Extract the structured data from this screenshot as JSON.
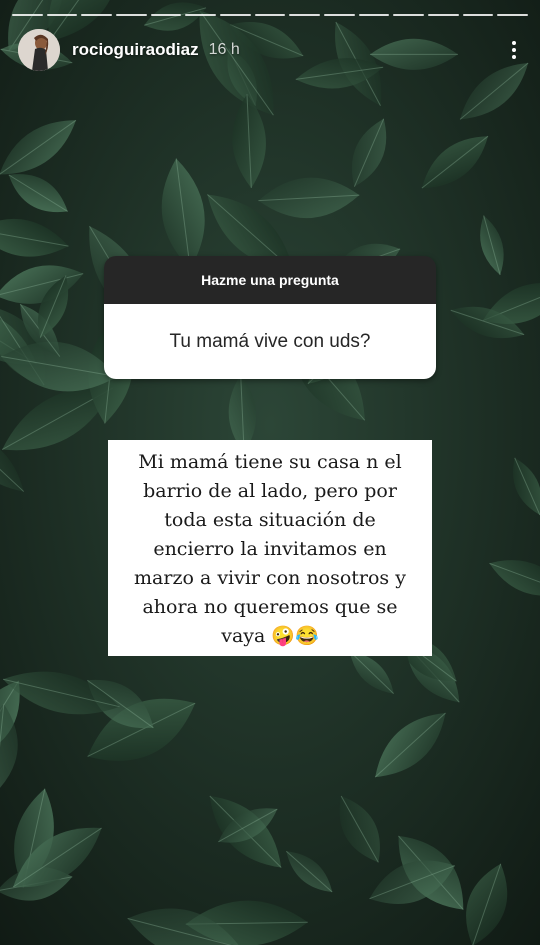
{
  "story": {
    "username": "rocioguiraodiaz",
    "time_ago": "16 h",
    "progress_segments": 15
  },
  "question_sticker": {
    "title": "Hazme una pregunta",
    "question": "Tu mamá vive con uds?"
  },
  "answer": {
    "lines": [
      "Mi mamá tiene su casa n el",
      "barrio de al lado, pero por",
      "toda esta situación de",
      "encierro la invitamos en",
      "marzo a vivir con nosotros y",
      "ahora no queremos que se",
      "vaya 🤪😂"
    ]
  },
  "icons": {
    "more": "more-vertical-icon"
  }
}
